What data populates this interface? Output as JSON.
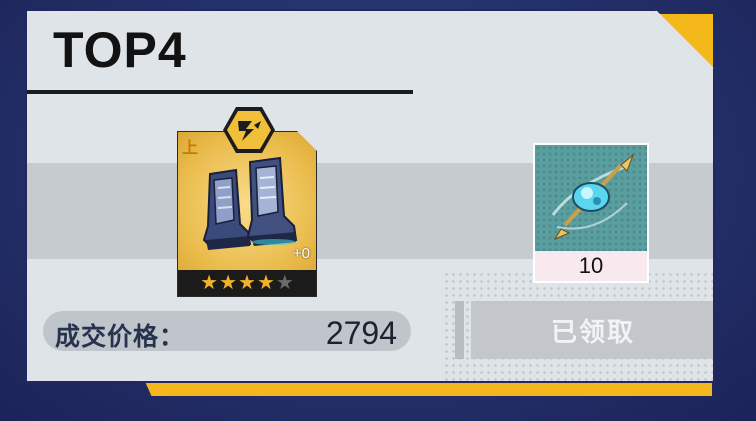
{
  "card": {
    "title": "TOP4"
  },
  "main_item": {
    "icon": "armored-boots-icon",
    "tier_label": "上",
    "enhance_level": "+0",
    "stars_filled": 4,
    "stars_total": 5,
    "type_icon": "lightning-attack-icon"
  },
  "side_item": {
    "icon": "crystal-lance-icon",
    "count": "10"
  },
  "price": {
    "label": "成交价格：",
    "value": "2794"
  },
  "claim": {
    "label": "已领取"
  },
  "colors": {
    "accent_yellow": "#f3b61c",
    "background_navy": "#24306a",
    "card_bg": "#dfe4e8",
    "star_gold": "#f2b12a"
  }
}
